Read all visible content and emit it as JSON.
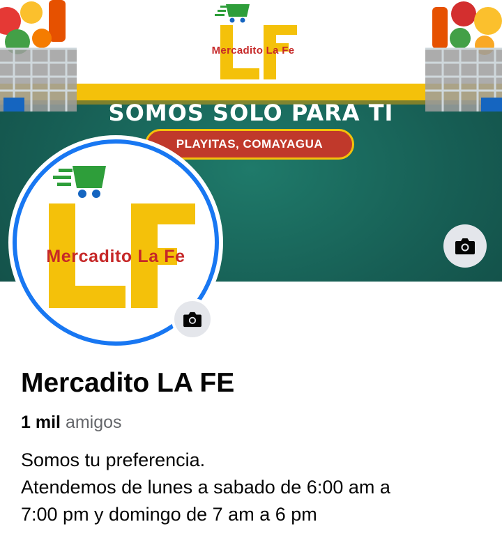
{
  "cover": {
    "logo_text": "Mercadito La Fe",
    "headline": "SOMOS SOLO PARA TI",
    "location": "PLAYITAS, COMAYAGUA"
  },
  "avatar": {
    "logo_text": "Mercadito La Fe"
  },
  "profile": {
    "name": "Mercadito LA FE",
    "friends_count": "1 mil",
    "friends_label": "amigos",
    "bio_lines": [
      "Somos tu preferencia.",
      "Atendemos de lunes a sabado de 6:00 am a",
      "7:00 pm y domingo de 7 am a 6 pm"
    ]
  },
  "icons": {
    "camera": "camera-icon",
    "cart": "shopping-cart-icon",
    "basket": "grocery-basket-illustration"
  },
  "colors": {
    "accent_blue": "#1877f2",
    "brand_yellow": "#f4c10a",
    "brand_red": "#c62828",
    "cover_green": "#175f55",
    "cart_green": "#2e9e3a"
  }
}
